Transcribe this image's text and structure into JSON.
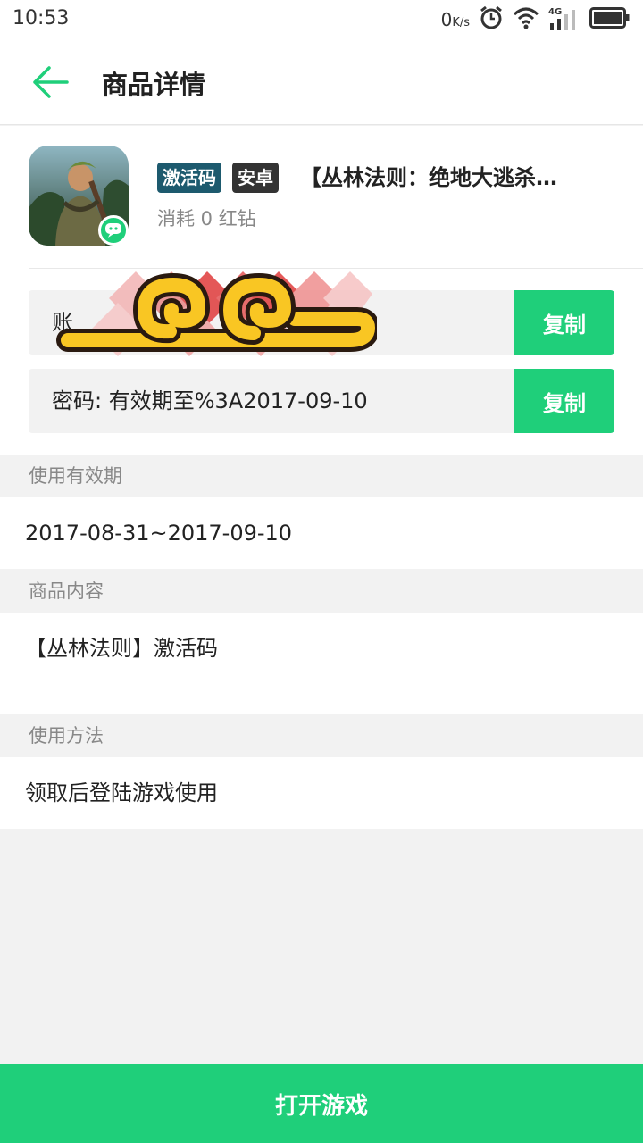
{
  "status_bar": {
    "time": "10:53",
    "net_speed_value": "0",
    "net_speed_unit": "K/s",
    "signal_type": "4G",
    "icons": [
      "alarm-icon",
      "wifi-icon",
      "signal-icon",
      "battery-icon"
    ]
  },
  "header": {
    "title": "商品详情",
    "back_icon": "arrow-left-icon"
  },
  "product": {
    "tag_code": "激活码",
    "tag_platform": "安卓",
    "name": "【丛林法则：绝地大逃杀…",
    "cost": "消耗 0 红钻"
  },
  "credentials": {
    "account_label": "账",
    "password_text": "密码: 有效期至%3A2017-09-10",
    "copy_label": "复制"
  },
  "sections": {
    "validity_label": "使用有效期",
    "validity_value": "2017-08-31~2017-09-10",
    "content_label": "商品内容",
    "content_value": "【丛林法则】激活码",
    "usage_label": "使用方法",
    "usage_value": "领取后登陆游戏使用"
  },
  "footer": {
    "open_game_label": "打开游戏"
  },
  "colors": {
    "accent": "#1fcf7a",
    "tag_code_bg": "#1d5a6e",
    "tag_platform_bg": "#333333",
    "overlay_yellow": "#f9c623",
    "overlay_red": "#e03b3b"
  }
}
